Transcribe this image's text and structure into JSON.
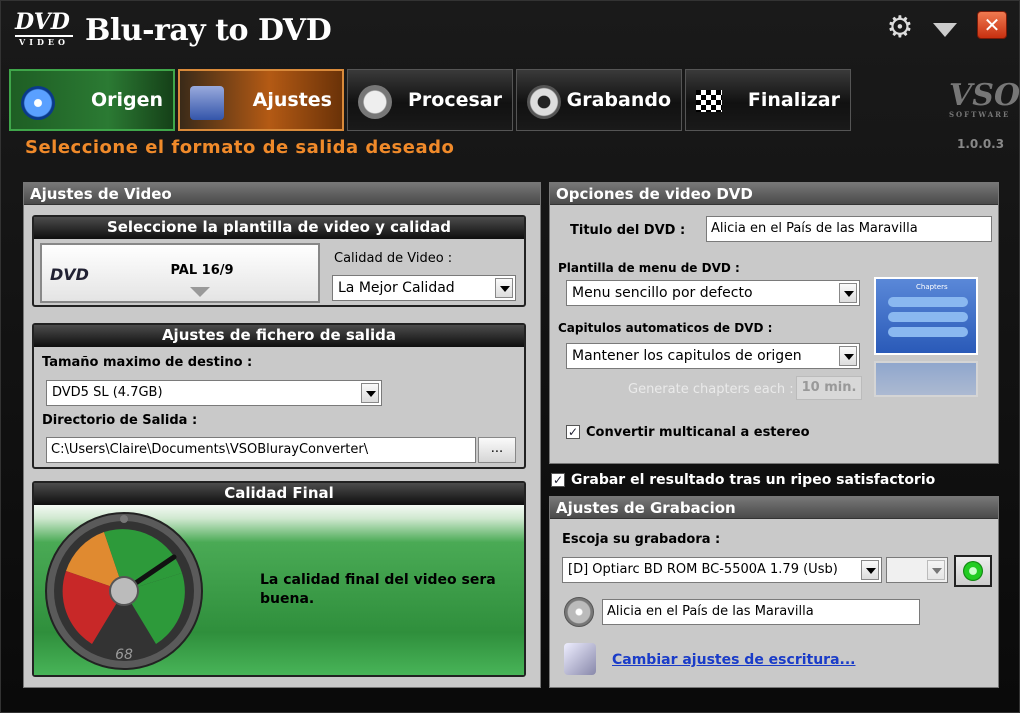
{
  "window": {
    "logo_text": "DVD",
    "logo_sub": "VIDEO",
    "title": "Blu-ray to DVD",
    "close_glyph": "✕",
    "gear_glyph": "⚙"
  },
  "tabs": [
    {
      "label": "Origen",
      "icon": "disc-icon"
    },
    {
      "label": "Ajustes",
      "icon": "settings-card-icon"
    },
    {
      "label": "Procesar",
      "icon": "clock-icon"
    },
    {
      "label": "Grabando",
      "icon": "burn-disc-icon"
    },
    {
      "label": "Finalizar",
      "icon": "checkered-flag-icon"
    }
  ],
  "brand": {
    "logo": "VSO",
    "logo_sub": "SOFTWARE",
    "version": "1.0.0.3"
  },
  "subtitle": "Seleccione el formato de salida deseado",
  "video_settings": {
    "title": "Ajustes de Video",
    "template_section": "Seleccione la plantilla de video y calidad",
    "template_logo": "DVD",
    "template_value": "PAL 16/9",
    "quality_label": "Calidad de Video :",
    "quality_value": "La Mejor Calidad",
    "output_section": "Ajustes de fichero de salida",
    "max_size_label": "Tamaño maximo de destino :",
    "max_size_value": "DVD5 SL (4.7GB)",
    "output_dir_label": "Directorio de Salida :",
    "output_dir_value": "C:\\Users\\Claire\\Documents\\VSOBlurayConverter\\",
    "browse_label": "...",
    "final_section": "Calidad Final",
    "final_text": "La calidad final del video sera buena.",
    "gauge_value": "68"
  },
  "dvd_options": {
    "title": "Opciones de video DVD",
    "dvd_title_label": "Titulo del DVD :",
    "dvd_title_value": "Alicia en el País de las Maravilla",
    "menu_template_label": "Plantilla de menu de DVD :",
    "menu_template_value": "Menu sencillo por defecto",
    "chapters_label": "Capitulos automaticos de DVD :",
    "chapters_value": "Mantener los capitulos de origen",
    "generate_label": "Generate chapters each :",
    "generate_value": "10 min.",
    "preview_title": "Chapters",
    "multichannel_label": "Convertir multicanal a estereo",
    "multichannel_checked": true
  },
  "burn_after": {
    "label": "Grabar el resultado tras un ripeo satisfactorio",
    "checked": true
  },
  "burn_settings": {
    "title": "Ajustes de Grabacion",
    "burner_label": "Escoja su grabadora :",
    "burner_value": "[D] Optiarc BD ROM BC-5500A 1.79 (Usb)",
    "volume_value": "Alicia en el País de las Maravilla",
    "write_settings_link": "Cambiar ajustes de escritura..."
  },
  "colors": {
    "accent_orange": "#f08a2a",
    "origen_green": "#2b7a33",
    "ajustes_orange": "#b45a14",
    "link_blue": "#1a3cc8"
  }
}
